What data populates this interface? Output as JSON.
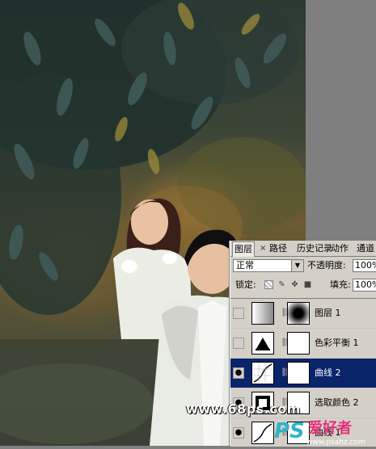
{
  "panel": {
    "tabs": [
      "图层",
      "路径",
      "历史记录",
      "动作",
      "通道"
    ],
    "tab_close": "×",
    "blend_mode": "正常",
    "opacity_label": "不透明度:",
    "opacity_value": "100%",
    "lock_label": "锁定:",
    "fill_label": "填充:",
    "fill_value": "100%"
  },
  "layers": [
    {
      "name": "图层 1",
      "visible": false,
      "selected": false,
      "type": "pixel-gradient"
    },
    {
      "name": "色彩平衡 1",
      "visible": false,
      "selected": false,
      "type": "color-balance"
    },
    {
      "name": "曲线 2",
      "visible": true,
      "selected": true,
      "type": "curves"
    },
    {
      "name": "选取颜色 2",
      "visible": true,
      "selected": false,
      "type": "selective-color"
    },
    {
      "name": "曲线 1",
      "visible": true,
      "selected": false,
      "type": "curves"
    }
  ],
  "watermarks": {
    "site": "www.68ps.com",
    "logo_text": "PS",
    "logo_cn": "爱好者",
    "logo_url": "www.psahz.com"
  },
  "colors": {
    "selection": "#0a246a",
    "panel_bg": "#d4d0c8",
    "canvas_gray": "#7f7f7f"
  }
}
